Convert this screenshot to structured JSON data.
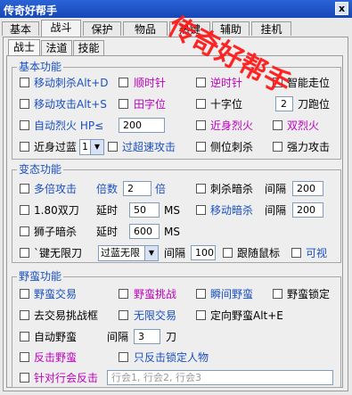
{
  "window": {
    "title": "传奇好帮手",
    "close_label": "x"
  },
  "tabs": [
    {
      "label": "基本"
    },
    {
      "label": "战斗"
    },
    {
      "label": "保护"
    },
    {
      "label": "物品"
    },
    {
      "label": "热键"
    },
    {
      "label": "辅助"
    },
    {
      "label": "挂机"
    }
  ],
  "subtabs": [
    {
      "label": "战士"
    },
    {
      "label": "法道"
    },
    {
      "label": "技能"
    }
  ],
  "watermark": "传奇好帮手",
  "basic": {
    "title": "基本功能",
    "r1": {
      "a": "移动刺杀Alt+D",
      "b": "顺时针",
      "c": "逆时针",
      "d": "智能走位"
    },
    "r2": {
      "a": "移动攻击Alt+S",
      "b": "田字位",
      "c": "十字位",
      "d_value": "2",
      "d": "刀跑位"
    },
    "r3": {
      "a": "自动烈火 HP≤",
      "a_value": "200",
      "c": "近身烈火",
      "d": "双烈火"
    },
    "r4": {
      "a": "近身过蓝",
      "a_select": "1",
      "b": "过超速攻击",
      "c": "侧位刺杀",
      "d": "强力攻击"
    }
  },
  "transform": {
    "title": "变态功能",
    "r1": {
      "a": "多倍攻击",
      "mult_label": "倍数",
      "mult_value": "2",
      "mult_unit": "倍",
      "c": "刺杀暗杀",
      "interval_label": "间隔",
      "interval_value": "200"
    },
    "r2": {
      "a": "1.80双刀",
      "delay_label": "延时",
      "delay_value": "50",
      "unit": "MS",
      "c": "移动暗杀",
      "interval_label": "间隔",
      "interval_value": "200"
    },
    "r3": {
      "a": "狮子暗杀",
      "delay_label": "延时",
      "delay_value": "600",
      "unit": "MS"
    },
    "r4": {
      "a": "`键无限刀",
      "select": "过蓝无限",
      "interval_label": "间隔",
      "interval_value": "100",
      "c": "跟随鼠标",
      "d": "可视"
    }
  },
  "savage": {
    "title": "野蛮功能",
    "r1": {
      "a": "野蛮交易",
      "b": "野蛮挑战",
      "c": "瞬间野蛮",
      "d": "野蛮锁定"
    },
    "r2": {
      "a": "去交易挑战框",
      "b": "无限交易",
      "c": "定向野蛮Alt+E"
    },
    "r3": {
      "a": "自动野蛮",
      "interval_label": "间隔",
      "interval_value": "3",
      "unit": "刀"
    },
    "r4": {
      "a": "反击野蛮",
      "b": "只反击锁定人物"
    },
    "r5": {
      "a": "针对行会反击",
      "placeholder": "行会1, 行会2, 行会3"
    }
  }
}
